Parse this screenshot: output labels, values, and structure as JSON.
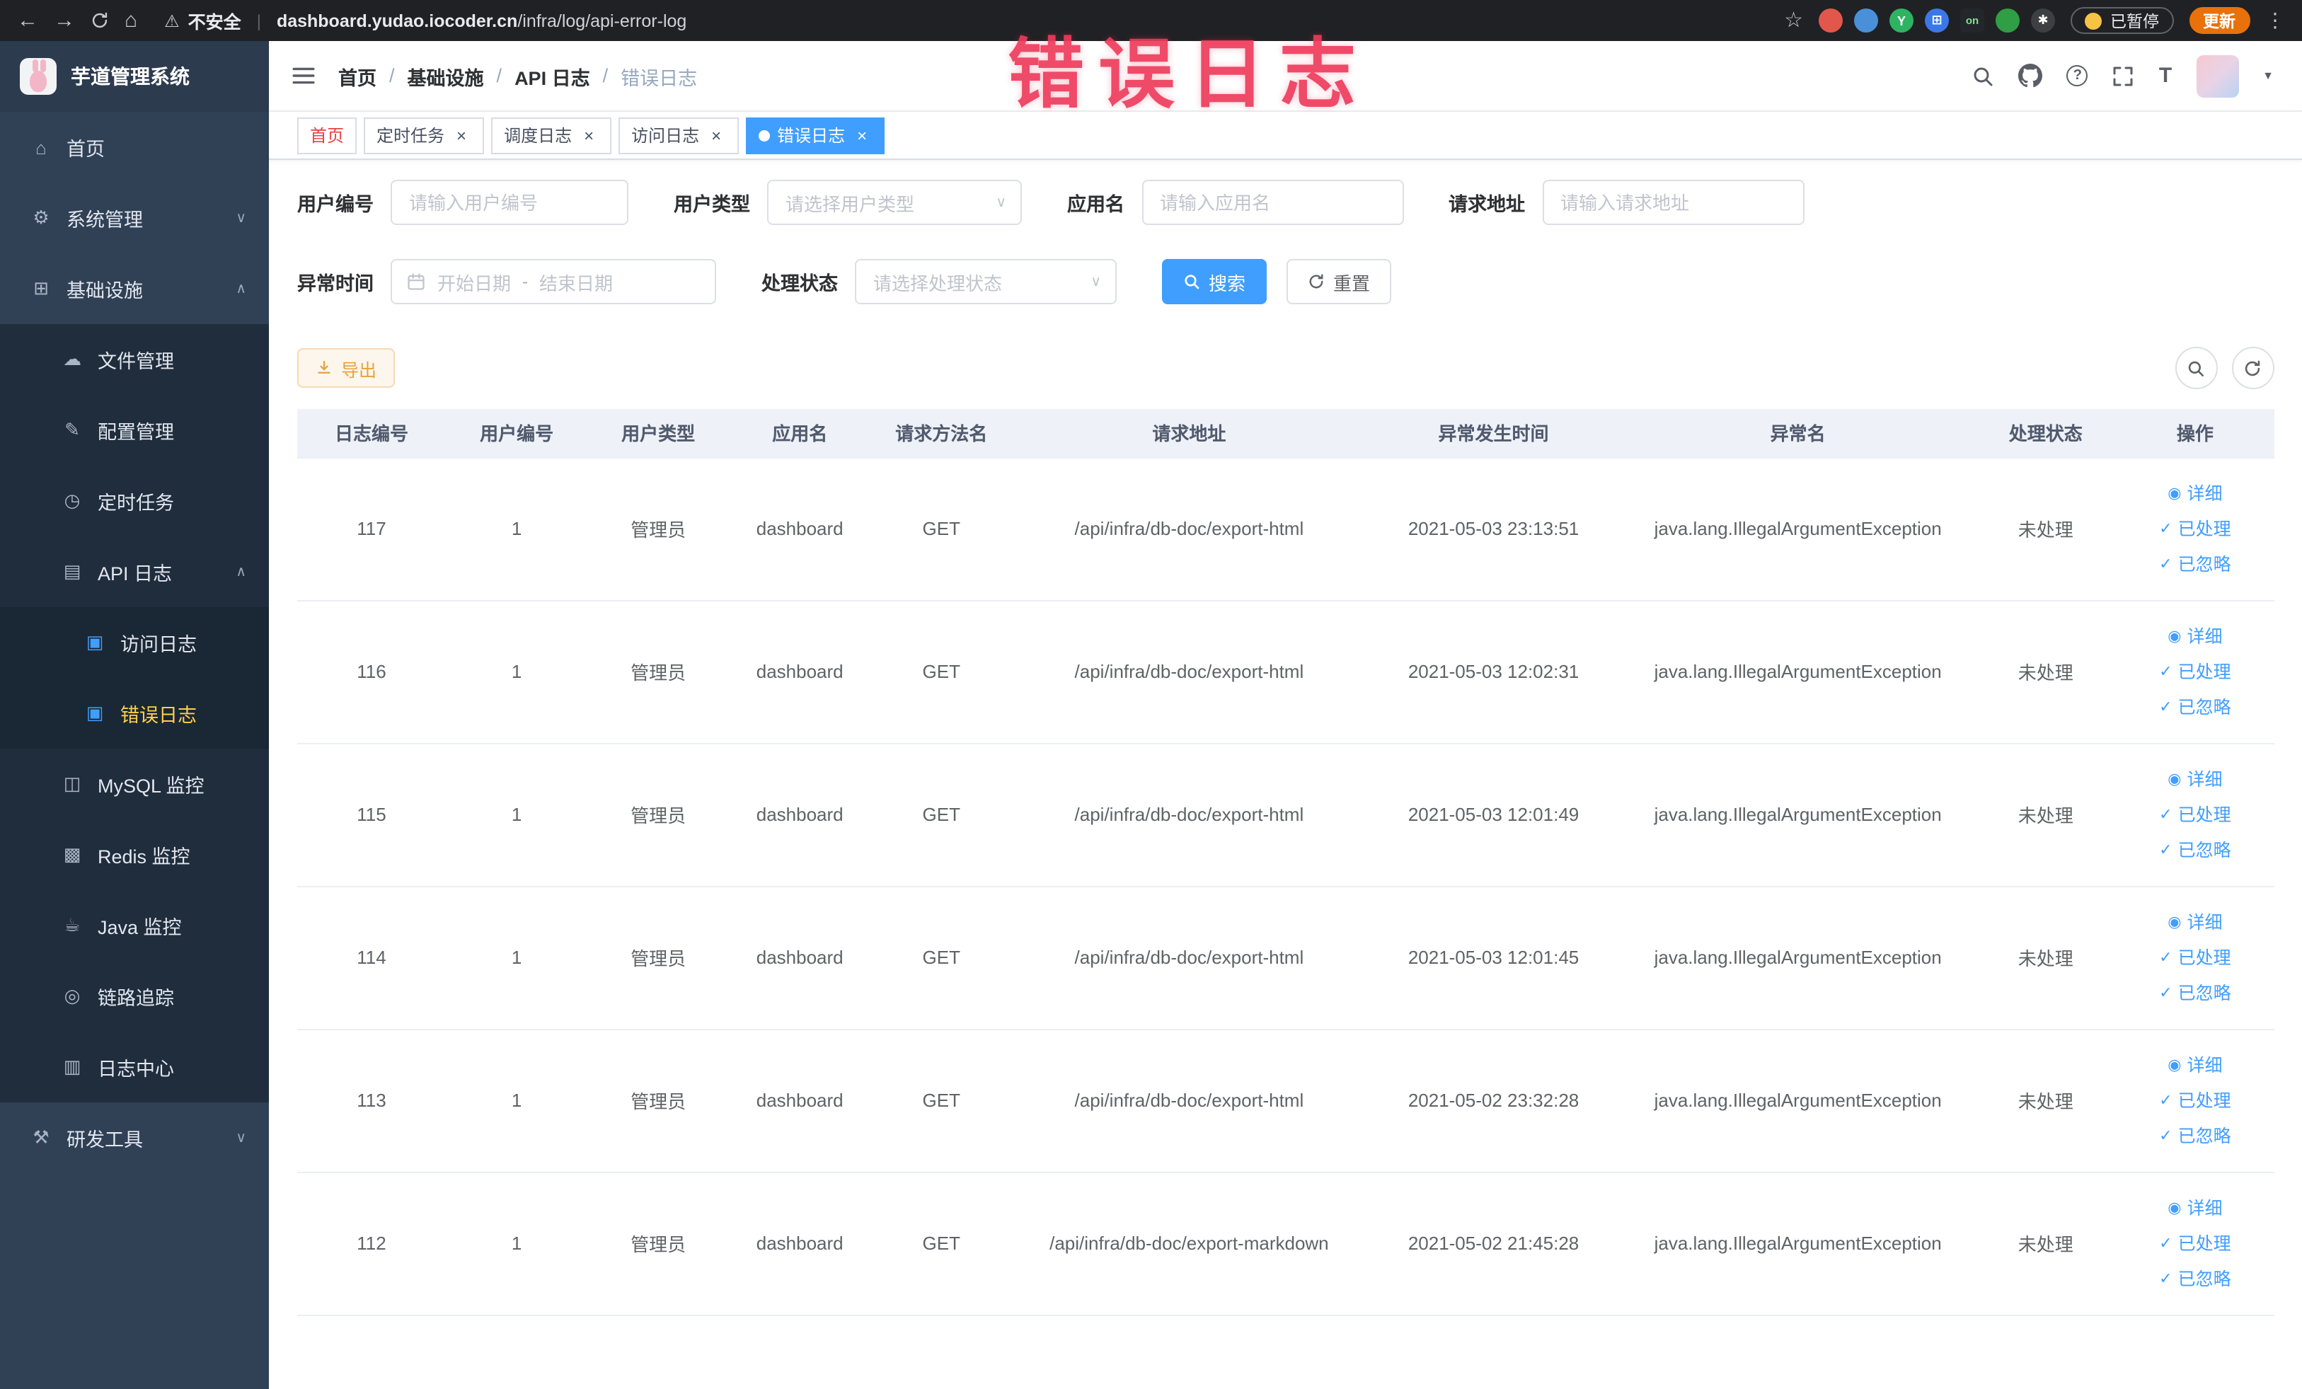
{
  "colors": {
    "primary": "#409EFF",
    "warning_text": "#e6a23c",
    "warning_bg": "#fdf6ec",
    "sidebar_bg": "#304156",
    "sidebar_sub_bg": "#1f2d3d",
    "sidebar_active_text": "#ffd04b",
    "active_tab_bg": "#409EFF",
    "annotation_red": "#ee3b5c",
    "table_header_bg": "#eef2f8"
  },
  "icons": {
    "home": "⌂",
    "gear": "⚙",
    "infra": "⊞",
    "file": "☁",
    "config": "✎",
    "cron": "◷",
    "api-log": "▤",
    "access-log": "▣",
    "error-log": "▣",
    "mysql": "◫",
    "redis": "▩",
    "java": "☕",
    "trace": "◎",
    "log-center": "▥",
    "tools": "⚒",
    "chevron-down": "∨",
    "chevron-up": "∧",
    "star": "☆",
    "warning": "⚠",
    "kebab": "⋮",
    "caret-down": "▼",
    "help": "?",
    "font-size": "T",
    "close": "×"
  },
  "annotation": {
    "text": "错误日志"
  },
  "browser": {
    "back_icon": "←",
    "forward_icon": "→",
    "home_icon": "⌂",
    "security_label": "不安全",
    "url_separator": "|",
    "url_domain": "dashboard.yudao.iocoder.cn",
    "url_path": "/infra/log/api-error-log",
    "paused_chip": "已暂停",
    "update_chip": "更新",
    "extensions": [
      {
        "id": "extension-red-ball",
        "bg": "#e2574c",
        "glyph": ""
      },
      {
        "id": "extension-blue-drop",
        "bg": "#4a90d9",
        "glyph": ""
      },
      {
        "id": "extension-green-y",
        "bg": "#2eb363",
        "glyph": "Y"
      },
      {
        "id": "extension-blue-grid",
        "bg": "#3b78e7",
        "glyph": "⊞"
      },
      {
        "id": "extension-on-badge",
        "bg": "#23272b",
        "glyph": "on",
        "fg": "#7ce38b",
        "shape": "square"
      },
      {
        "id": "extension-green-tree",
        "bg": "#2f9e44",
        "glyph": ""
      },
      {
        "id": "extension-dark-paw",
        "bg": "#3c4043",
        "glyph": "✱"
      }
    ]
  },
  "sidebar": {
    "logo_title": "芋道管理系统",
    "items": [
      {
        "id": "home",
        "label": "首页",
        "level": 1,
        "icon": "home"
      },
      {
        "id": "system-mgmt",
        "label": "系统管理",
        "level": 1,
        "icon": "gear",
        "chevron": "down"
      },
      {
        "id": "infrastructure",
        "label": "基础设施",
        "level": 1,
        "icon": "infra",
        "chevron": "up"
      },
      {
        "id": "file-mgmt",
        "label": "文件管理",
        "level": 2,
        "icon": "file"
      },
      {
        "id": "config-mgmt",
        "label": "配置管理",
        "level": 2,
        "icon": "config"
      },
      {
        "id": "cron-job",
        "label": "定时任务",
        "level": 2,
        "icon": "cron"
      },
      {
        "id": "api-log",
        "label": "API 日志",
        "level": 2,
        "icon": "api-log",
        "chevron": "up"
      },
      {
        "id": "access-log",
        "label": "访问日志",
        "level": 3,
        "icon": "access-log",
        "icon_color": "#409EFF"
      },
      {
        "id": "error-log",
        "label": "错误日志",
        "level": 3,
        "icon": "error-log",
        "icon_color": "#409EFF",
        "active": true
      },
      {
        "id": "mysql-monitor",
        "label": "MySQL 监控",
        "level": 2,
        "icon": "mysql"
      },
      {
        "id": "redis-monitor",
        "label": "Redis 监控",
        "level": 2,
        "icon": "redis"
      },
      {
        "id": "java-monitor",
        "label": "Java 监控",
        "level": 2,
        "icon": "java"
      },
      {
        "id": "trace",
        "label": "链路追踪",
        "level": 2,
        "icon": "trace"
      },
      {
        "id": "log-center",
        "label": "日志中心",
        "level": 2,
        "icon": "log-center"
      },
      {
        "id": "dev-tools",
        "label": "研发工具",
        "level": 1,
        "icon": "tools",
        "chevron": "down"
      }
    ]
  },
  "header": {
    "breadcrumb": [
      "首页",
      "基础设施",
      "API 日志",
      "错误日志"
    ]
  },
  "tabs": [
    {
      "id": "home",
      "label": "首页",
      "closable": false,
      "active": false,
      "color": "#e64242"
    },
    {
      "id": "cron-job",
      "label": "定时任务",
      "closable": true,
      "active": false
    },
    {
      "id": "job-log",
      "label": "调度日志",
      "closable": true,
      "active": false
    },
    {
      "id": "access-log",
      "label": "访问日志",
      "closable": true,
      "active": false
    },
    {
      "id": "error-log",
      "label": "错误日志",
      "closable": true,
      "active": true
    }
  ],
  "filters": {
    "user_id": {
      "label": "用户编号",
      "placeholder": "请输入用户编号"
    },
    "user_type": {
      "label": "用户类型",
      "placeholder": "请选择用户类型"
    },
    "app_name": {
      "label": "应用名",
      "placeholder": "请输入应用名"
    },
    "request_url": {
      "label": "请求地址",
      "placeholder": "请输入请求地址"
    },
    "exception_time": {
      "label": "异常时间",
      "start_placeholder": "开始日期",
      "separator": "-",
      "end_placeholder": "结束日期"
    },
    "process_status": {
      "label": "处理状态",
      "placeholder": "请选择处理状态"
    },
    "search_label": "搜索",
    "reset_label": "重置"
  },
  "toolbar": {
    "export_label": "导出"
  },
  "table": {
    "columns": [
      "日志编号",
      "用户编号",
      "用户类型",
      "应用名",
      "请求方法名",
      "请求地址",
      "异常发生时间",
      "异常名",
      "处理状态",
      "操作"
    ],
    "row_actions": [
      {
        "id": "detail",
        "label": "详细",
        "icon": "eye",
        "glyph": "◉"
      },
      {
        "id": "processed",
        "label": "已处理",
        "icon": "check",
        "glyph": "✓"
      },
      {
        "id": "ignored",
        "label": "已忽略",
        "icon": "check",
        "glyph": "✓"
      }
    ],
    "rows": [
      {
        "cells": [
          "117",
          "1",
          "管理员",
          "dashboard",
          "GET",
          "/api/infra/db-doc/export-html",
          "2021-05-03 23:13:51",
          "java.lang.IllegalArgumentException",
          "未处理"
        ]
      },
      {
        "cells": [
          "116",
          "1",
          "管理员",
          "dashboard",
          "GET",
          "/api/infra/db-doc/export-html",
          "2021-05-03 12:02:31",
          "java.lang.IllegalArgumentException",
          "未处理"
        ]
      },
      {
        "cells": [
          "115",
          "1",
          "管理员",
          "dashboard",
          "GET",
          "/api/infra/db-doc/export-html",
          "2021-05-03 12:01:49",
          "java.lang.IllegalArgumentException",
          "未处理"
        ]
      },
      {
        "cells": [
          "114",
          "1",
          "管理员",
          "dashboard",
          "GET",
          "/api/infra/db-doc/export-html",
          "2021-05-03 12:01:45",
          "java.lang.IllegalArgumentException",
          "未处理"
        ]
      },
      {
        "cells": [
          "113",
          "1",
          "管理员",
          "dashboard",
          "GET",
          "/api/infra/db-doc/export-html",
          "2021-05-02 23:32:28",
          "java.lang.IllegalArgumentException",
          "未处理"
        ]
      },
      {
        "cells": [
          "112",
          "1",
          "管理员",
          "dashboard",
          "GET",
          "/api/infra/db-doc/export-markdown",
          "2021-05-02 21:45:28",
          "java.lang.IllegalArgumentException",
          "未处理"
        ]
      }
    ]
  }
}
